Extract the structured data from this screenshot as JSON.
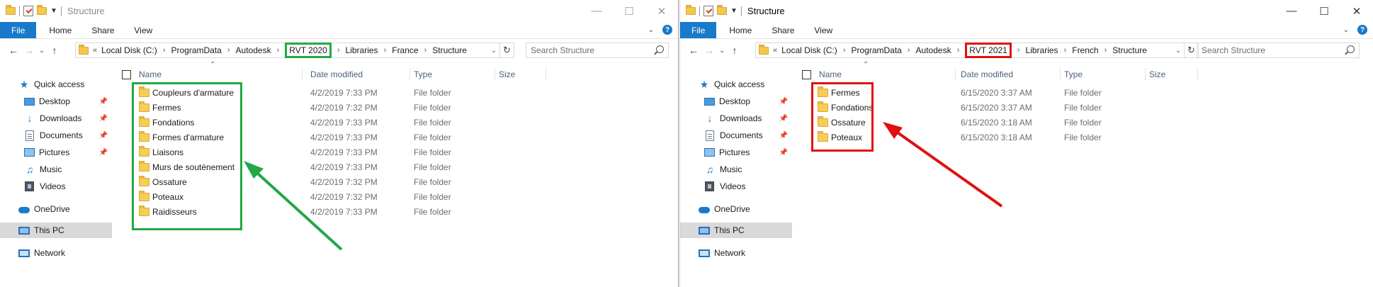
{
  "left": {
    "title": "Structure",
    "ribbon_tabs": [
      "File",
      "Home",
      "Share",
      "View"
    ],
    "breadcrumbs": [
      "Local Disk (C:)",
      "ProgramData",
      "Autodesk",
      "RVT 2020",
      "Libraries",
      "France",
      "Structure"
    ],
    "breadcrumb_lead": "«",
    "search_placeholder": "Search Structure",
    "columns": [
      "Name",
      "Date modified",
      "Type",
      "Size"
    ],
    "nav": [
      {
        "label": "Quick access",
        "icon": "star-icon"
      },
      {
        "label": "Desktop",
        "icon": "desktop-icon",
        "pinned": true
      },
      {
        "label": "Downloads",
        "icon": "download-icon",
        "pinned": true
      },
      {
        "label": "Documents",
        "icon": "document-icon",
        "pinned": true
      },
      {
        "label": "Pictures",
        "icon": "pictures-icon",
        "pinned": true
      },
      {
        "label": "Music",
        "icon": "music-icon"
      },
      {
        "label": "Videos",
        "icon": "videos-icon"
      },
      {
        "label": "OneDrive",
        "icon": "cloud-icon"
      },
      {
        "label": "This PC",
        "icon": "pc-icon",
        "selected": true
      },
      {
        "label": "Network",
        "icon": "network-icon"
      }
    ],
    "files": [
      {
        "name": "Coupleurs d'armature",
        "date": "4/2/2019 7:33 PM",
        "type": "File folder"
      },
      {
        "name": "Fermes",
        "date": "4/2/2019 7:32 PM",
        "type": "File folder"
      },
      {
        "name": "Fondations",
        "date": "4/2/2019 7:33 PM",
        "type": "File folder"
      },
      {
        "name": "Formes d'armature",
        "date": "4/2/2019 7:33 PM",
        "type": "File folder"
      },
      {
        "name": "Liaisons",
        "date": "4/2/2019 7:33 PM",
        "type": "File folder"
      },
      {
        "name": "Murs de soutènement",
        "date": "4/2/2019 7:33 PM",
        "type": "File folder"
      },
      {
        "name": "Ossature",
        "date": "4/2/2019 7:32 PM",
        "type": "File folder"
      },
      {
        "name": "Poteaux",
        "date": "4/2/2019 7:32 PM",
        "type": "File folder"
      },
      {
        "name": "Raidisseurs",
        "date": "4/2/2019 7:33 PM",
        "type": "File folder"
      }
    ]
  },
  "right": {
    "title": "Structure",
    "ribbon_tabs": [
      "File",
      "Home",
      "Share",
      "View"
    ],
    "breadcrumbs": [
      "Local Disk (C:)",
      "ProgramData",
      "Autodesk",
      "RVT 2021",
      "Libraries",
      "French",
      "Structure"
    ],
    "breadcrumb_lead": "«",
    "search_placeholder": "Search Structure",
    "columns": [
      "Name",
      "Date modified",
      "Type",
      "Size"
    ],
    "nav": [
      {
        "label": "Quick access",
        "icon": "star-icon"
      },
      {
        "label": "Desktop",
        "icon": "desktop-icon",
        "pinned": true
      },
      {
        "label": "Downloads",
        "icon": "download-icon",
        "pinned": true
      },
      {
        "label": "Documents",
        "icon": "document-icon",
        "pinned": true
      },
      {
        "label": "Pictures",
        "icon": "pictures-icon",
        "pinned": true
      },
      {
        "label": "Music",
        "icon": "music-icon"
      },
      {
        "label": "Videos",
        "icon": "videos-icon"
      },
      {
        "label": "OneDrive",
        "icon": "cloud-icon"
      },
      {
        "label": "This PC",
        "icon": "pc-icon",
        "selected": true
      },
      {
        "label": "Network",
        "icon": "network-icon"
      }
    ],
    "files": [
      {
        "name": "Fermes",
        "date": "6/15/2020 3:37 AM",
        "type": "File folder"
      },
      {
        "name": "Fondations",
        "date": "6/15/2020 3:37 AM",
        "type": "File folder"
      },
      {
        "name": "Ossature",
        "date": "6/15/2020 3:18 AM",
        "type": "File folder"
      },
      {
        "name": "Poteaux",
        "date": "6/15/2020 3:18 AM",
        "type": "File folder"
      }
    ]
  },
  "colors": {
    "accent": "#1979ca",
    "highlight_left": "#22a845",
    "highlight_right": "#e01010",
    "folder": "#f7cd58"
  }
}
